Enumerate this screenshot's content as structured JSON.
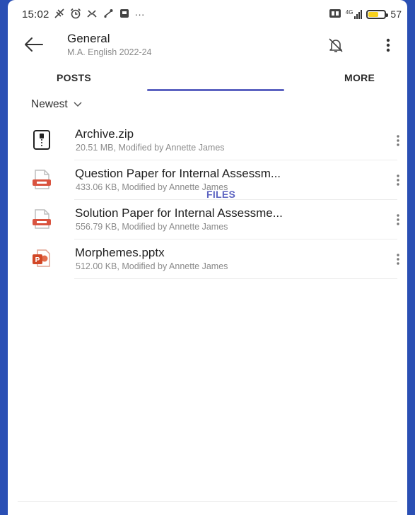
{
  "status_bar": {
    "time": "15:02",
    "notif_icons": [
      "data-saver-icon",
      "alarm-icon",
      "hotspot-icon",
      "link-icon",
      "message-icon"
    ],
    "overflow": "···",
    "network": "4G",
    "battery_percent": "57",
    "battery_level": 0.57
  },
  "header": {
    "title": "General",
    "subtitle": "M.A. English 2022-24"
  },
  "tabs": [
    {
      "label": "POSTS",
      "active": false
    },
    {
      "label": "FILES",
      "active": true
    },
    {
      "label": "MORE",
      "active": false
    }
  ],
  "sort": {
    "label": "Newest"
  },
  "files": [
    {
      "name": "Archive.zip",
      "meta": "20.51 MB, Modified by Annette James",
      "type": "zip-file-icon"
    },
    {
      "name": "Question Paper for Internal Assessm...",
      "meta": "433.06 KB, Modified by Annette James",
      "type": "generic-document-icon"
    },
    {
      "name": "Solution Paper for Internal Assessme...",
      "meta": "556.79 KB, Modified by Annette James",
      "type": "generic-document-icon"
    },
    {
      "name": "Morphemes.pptx",
      "meta": "512.00 KB, Modified by Annette James",
      "type": "powerpoint-file-icon"
    }
  ],
  "colors": {
    "accent": "#5c63c1",
    "frame": "#2a4fb4",
    "doc_icon": "#d9533f",
    "ppt_icon": "#d24726",
    "battery_fill": "#f7d21e"
  }
}
